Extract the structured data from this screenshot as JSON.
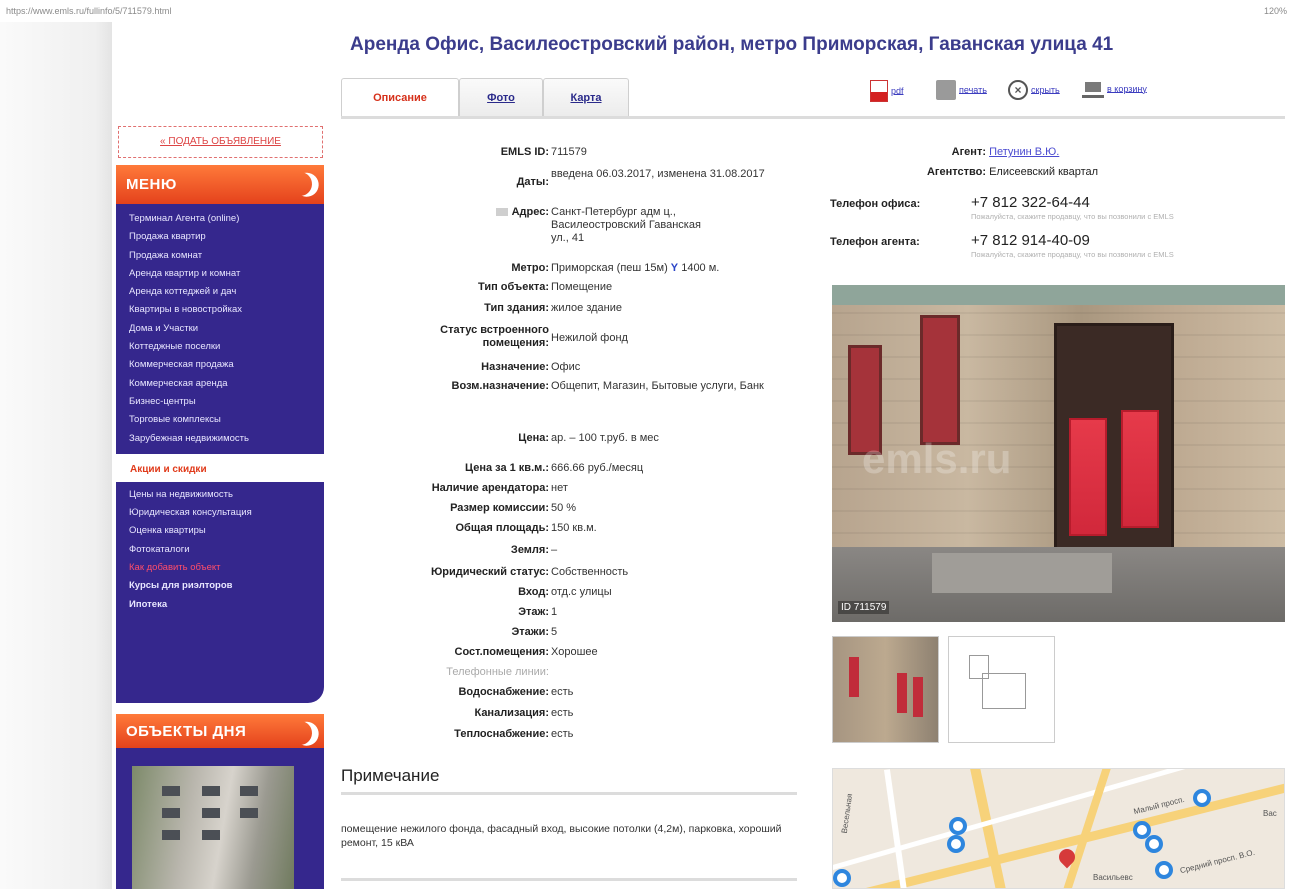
{
  "browser": {
    "url": "https://www.emls.ru/fullinfo/5/711579.html",
    "url_domain": "emls.ru",
    "zoom": "120%"
  },
  "page_title": "Аренда Офис, Василеостровский район, метро Приморская, Гаванская улица 41",
  "sidebar": {
    "post_ad": "« ПОДАТЬ ОБЪЯВЛЕНИЕ",
    "menu_title": "МЕНЮ",
    "menu_items": [
      "Терминал Агента (online)",
      "Продажа квартир",
      "Продажа комнат",
      "Аренда квартир и комнат",
      "Аренда коттеджей и дач",
      "Квартиры в новостройках",
      "Дома и Участки",
      "Коттеджные поселки",
      "Коммерческая продажа",
      "Коммерческая аренда",
      "Бизнес-центры",
      "Торговые комплексы",
      "Зарубежная недвижимость"
    ],
    "promo": "Акции и скидки",
    "menu_items_2": [
      "Цены на недвижимость",
      "Юридическая консультация",
      "Оценка квартиры",
      "Фотокаталоги",
      "Как добавить объект",
      "Курсы для риэлторов",
      "Ипотека"
    ],
    "objects_title": "ОБЪЕКТЫ ДНЯ"
  },
  "tabs": [
    "Описание",
    "Фото",
    "Карта"
  ],
  "actions": [
    "pdf",
    "печать",
    "скрыть",
    "в корзину"
  ],
  "details": [
    {
      "k": "EMLS ID:",
      "v": "711579"
    },
    {
      "k": "Даты:",
      "v": "введена 06.03.2017, изменена 31.08.2017"
    },
    {
      "k": "Адрес:",
      "v": "Санкт-Петербург адм ц., Василеостровский Гаванская ул., 41"
    },
    {
      "k": "Метро:",
      "v": "Приморская (пеш 15м)",
      "v2": "1400 м."
    },
    {
      "k": "Тип объекта:",
      "v": "Помещение"
    },
    {
      "k": "Тип здания:",
      "v": "жилое здание"
    },
    {
      "k": "Статус встроенного помещения:",
      "v": "Нежилой фонд"
    },
    {
      "k": "Назначение:",
      "v": "Офис"
    },
    {
      "k": "Возм.назначение:",
      "v": "Общепит, Магазин, Бытовые услуги, Банк"
    },
    {
      "k": "Цена:",
      "v": "ар. – 100 т.руб. в мес"
    },
    {
      "k": "Цена за 1 кв.м.:",
      "v": "666.66 руб./месяц"
    },
    {
      "k": "Наличие арендатора:",
      "v": "нет"
    },
    {
      "k": "Размер комиссии:",
      "v": "50 %"
    },
    {
      "k": "Общая площадь:",
      "v": "150 кв.м."
    },
    {
      "k": "Земля:",
      "v": "–"
    },
    {
      "k": "Юридический статус:",
      "v": "Собственность"
    },
    {
      "k": "Вход:",
      "v": "отд.с улицы"
    },
    {
      "k": "Этаж:",
      "v": "1"
    },
    {
      "k": "Этажи:",
      "v": "5"
    },
    {
      "k": "Сост.помещения:",
      "v": "Хорошее"
    },
    {
      "k": "Телефонные линии:",
      "v": ""
    },
    {
      "k": "Водоснабжение:",
      "v": "есть"
    },
    {
      "k": "Канализация:",
      "v": "есть"
    },
    {
      "k": "Теплоснабжение:",
      "v": "есть"
    }
  ],
  "notes": {
    "title": "Примечание",
    "text": "помещение нежилого фонда, фасадный вход, высокие потолки (4,2м), парковка, хороший ремонт, 15 кВА"
  },
  "contacts": {
    "agent_label": "Агент:",
    "agent": "Петунин В.Ю.",
    "agency_label": "Агентство:",
    "agency": "Елисеевский квартал",
    "office_label": "Телефон офиса:",
    "office_phone": "+7 812 322-64-44",
    "office_note": "Пожалуйста, скажите продавцу, что вы позвонили с EMLS",
    "agent_phone_label": "Телефон агента:",
    "agent_phone": "+7 812 914-40-09",
    "agent_note": "Пожалуйста, скажите продавцу, что вы позвонили с EMLS"
  },
  "photo": {
    "id_label": "ID 711579",
    "watermark": "emls.ru"
  },
  "map": {
    "labels": [
      "Васильевс",
      "Средний просп. В.О.",
      "Малый просп.",
      "Весельная",
      "Вас"
    ]
  }
}
